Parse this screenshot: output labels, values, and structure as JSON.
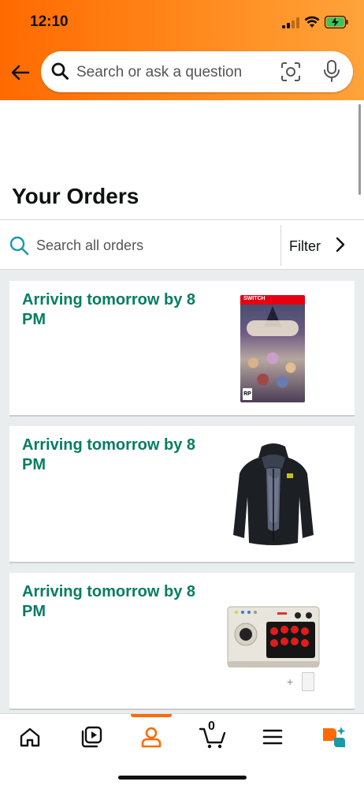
{
  "status_bar": {
    "time": "12:10"
  },
  "search": {
    "placeholder": "Search or ask a question"
  },
  "page": {
    "title": "Your Orders"
  },
  "order_search": {
    "placeholder": "Search all orders",
    "filter_label": "Filter"
  },
  "orders": [
    {
      "status": "Arriving tomorrow by 8 PM",
      "product_icon": "game-cover-image"
    },
    {
      "status": "Arriving tomorrow by 8 PM",
      "product_icon": "jacket-image"
    },
    {
      "status": "Arriving tomorrow by 8 PM",
      "product_icon": "arcade-stick-image"
    }
  ],
  "bottom_nav": {
    "items": [
      "home-icon",
      "video-icon",
      "account-icon",
      "cart-icon",
      "menu-icon",
      "rufus-icon"
    ],
    "active": "account-icon",
    "cart_count": "0"
  },
  "colors": {
    "header_gradient_start": "#ff6a00",
    "header_gradient_end": "#ffa33a",
    "status_green": "#067d62",
    "active_orange": "#ff6a00",
    "search_teal": "#007185"
  }
}
